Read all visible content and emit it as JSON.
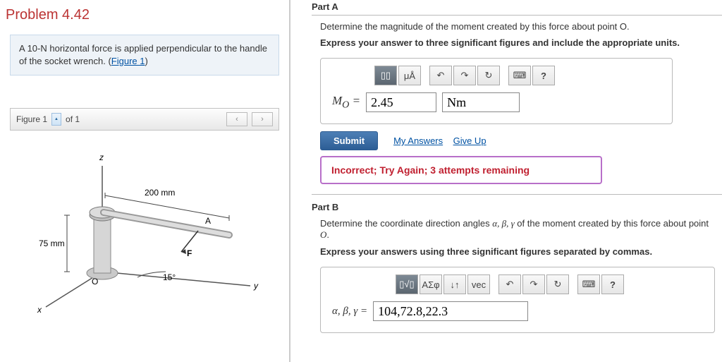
{
  "problem": {
    "title": "Problem 4.42",
    "description_prefix": "A 10-",
    "description_force": "N",
    "description_mid": " horizontal force is applied perpendicular to the handle of the socket wrench. (",
    "figure_link": "Figure 1",
    "description_suffix": ")"
  },
  "figure_bar": {
    "label": "Figure 1",
    "of_text": "of 1"
  },
  "figure": {
    "dim1": "200 mm",
    "dim2": "75 mm",
    "angle": "15°",
    "axes": {
      "x": "x",
      "y": "y",
      "z": "z"
    },
    "pointA": "A",
    "pointO": "O",
    "forceF": "F"
  },
  "partA": {
    "header": "Part A",
    "question": "Determine the magnitude of the moment created by this force about point O.",
    "instruction": "Express your answer to three significant figures and include the appropriate units.",
    "toolbar": {
      "t1": "▯▯",
      "t2": "μÅ",
      "undo": "↶",
      "redo": "↷",
      "reset": "↻",
      "kbd": "⌨",
      "help": "?"
    },
    "label_html": "M",
    "label_sub": "O",
    "equals": " = ",
    "value": "2.45",
    "unit": "Nm",
    "submit": "Submit",
    "my_answers": "My Answers",
    "give_up": "Give Up",
    "feedback": "Incorrect; Try Again; 3 attempts remaining"
  },
  "partB": {
    "header": "Part B",
    "question_prefix": "Determine the coordinate direction angles ",
    "question_syms": "α, β, γ",
    "question_mid": " of the moment created by this force about point ",
    "question_o": "O",
    "question_suffix": ".",
    "instruction": "Express your answers using three significant figures separated by commas.",
    "toolbar": {
      "t1": "▯√▯",
      "t2": "ΑΣφ",
      "t3": "↓↑",
      "t4": "vec",
      "undo": "↶",
      "redo": "↷",
      "reset": "↻",
      "kbd": "⌨",
      "help": "?"
    },
    "label": "α, β, γ = ",
    "value": "104,72.8,22.3"
  }
}
